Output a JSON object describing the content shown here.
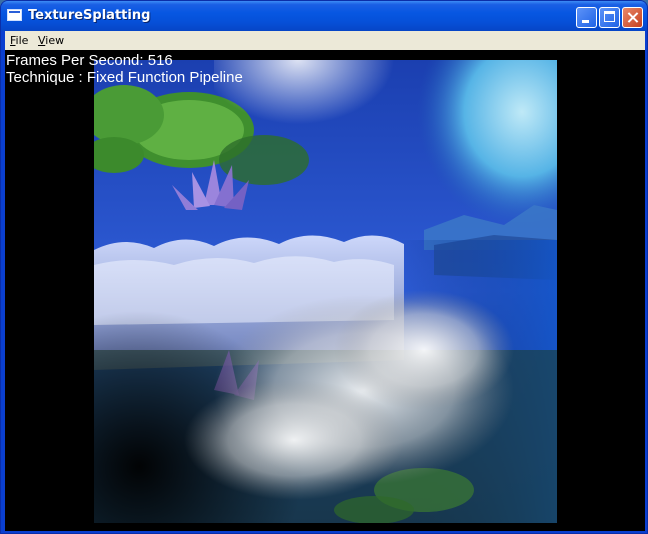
{
  "window": {
    "title": "TextureSplatting"
  },
  "menu": {
    "file": "File",
    "file_key": "F",
    "file_rest": "ile",
    "view": "View",
    "view_key": "V",
    "view_rest": "iew"
  },
  "overlay": {
    "fps_label": "Frames Per Second: 516",
    "technique_label": "Technique : Fixed Function Pipeline"
  },
  "colors": {
    "titlebar": "#0757e2",
    "menubar": "#ece9d8",
    "client_bg": "#000000",
    "close_button": "#c6401d",
    "overlay_text": "#ffffff"
  }
}
